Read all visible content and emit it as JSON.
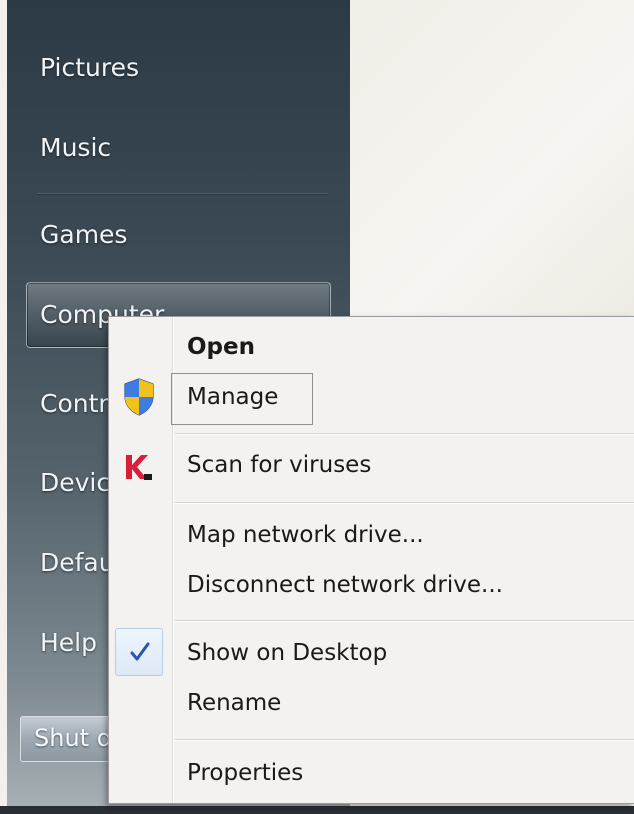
{
  "start_menu": {
    "items": [
      {
        "label": "Pictures"
      },
      {
        "label": "Music"
      },
      {
        "label": "Games"
      },
      {
        "label": "Computer"
      },
      {
        "label": "Contr"
      },
      {
        "label": "Devic"
      },
      {
        "label": "Defau"
      },
      {
        "label": "Help"
      }
    ],
    "shutdown_label": "Shut d"
  },
  "context_menu": {
    "items": [
      {
        "label": "Open",
        "bold": true
      },
      {
        "label": "Manage",
        "icon": "uac-shield-icon",
        "focused": true
      },
      {
        "label": "Scan for viruses",
        "icon": "kaspersky-icon"
      },
      {
        "label": "Map network drive..."
      },
      {
        "label": "Disconnect network drive..."
      },
      {
        "label": "Show on Desktop",
        "icon": "checkmark-icon",
        "checked": true
      },
      {
        "label": "Rename"
      },
      {
        "label": "Properties"
      }
    ]
  },
  "colors": {
    "start_menu_top": "#2c3a46",
    "start_menu_bottom": "#a6afb4",
    "menu_background": "#f3f2f0",
    "checkmark": "#2b55b5",
    "kaspersky_red": "#d6203a"
  }
}
